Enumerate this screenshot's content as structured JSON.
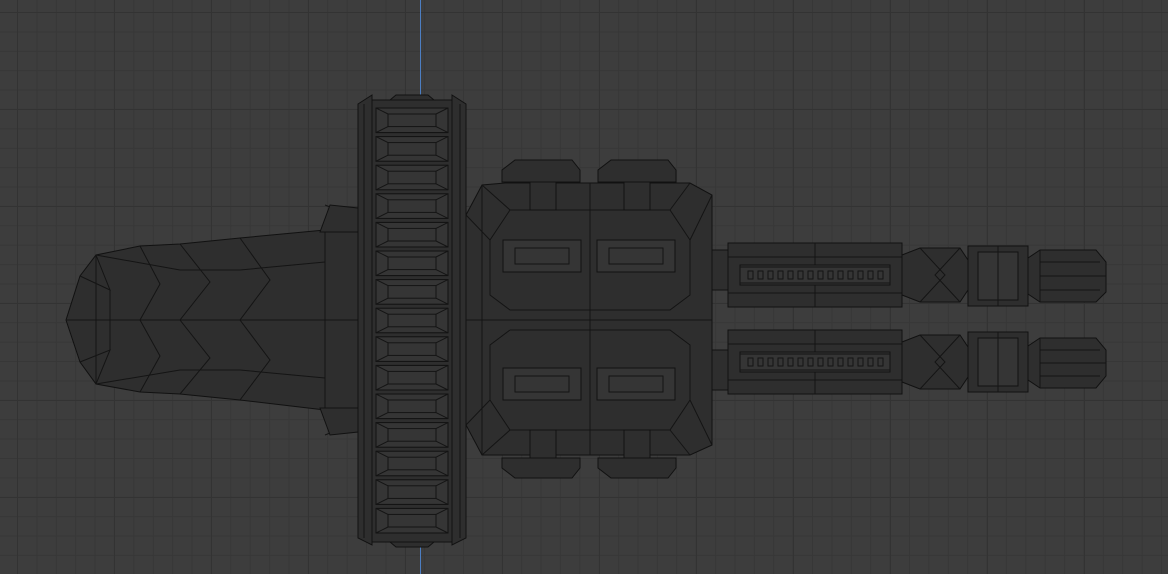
{
  "viewport": {
    "view": "orthographic-top",
    "overlay": "wireframe",
    "colors": {
      "background": "#3d3d3d",
      "grid_minor": "#373737",
      "grid_major": "#333333",
      "axis": "#4c7ec2",
      "mesh_fill": "#2e2e2e",
      "mesh_edge": "#111111"
    },
    "object": {
      "icon": "spaceship-mesh-icon",
      "parts": [
        "nose-cone",
        "hull-segments",
        "rotating-ring",
        "central-block",
        "engine-rails",
        "thrusters"
      ]
    }
  }
}
